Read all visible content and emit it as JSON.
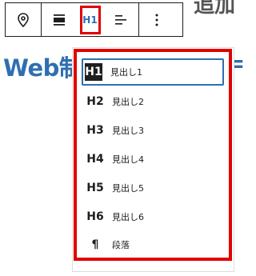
{
  "background": {
    "heading_visible": "Web制",
    "heading_right_fragment": "=",
    "top_right_fragment": "追加"
  },
  "toolbar": {
    "pin_icon": "map-pin-icon",
    "align_icon": "align-icon",
    "heading_level": "H1",
    "text_align_icon": "text-align-left-icon",
    "more_icon": "more-vertical-icon"
  },
  "dropdown": {
    "items": [
      {
        "level": "H1",
        "label": "見出し1"
      },
      {
        "level": "H2",
        "label": "見出し2"
      },
      {
        "level": "H3",
        "label": "見出し3"
      },
      {
        "level": "H4",
        "label": "見出し4"
      },
      {
        "level": "H5",
        "label": "見出し5"
      },
      {
        "level": "H6",
        "label": "見出し6"
      },
      {
        "level": "¶",
        "label": "段落"
      }
    ]
  },
  "colors": {
    "accent": "#2f6fb0",
    "highlight": "#e00000"
  }
}
